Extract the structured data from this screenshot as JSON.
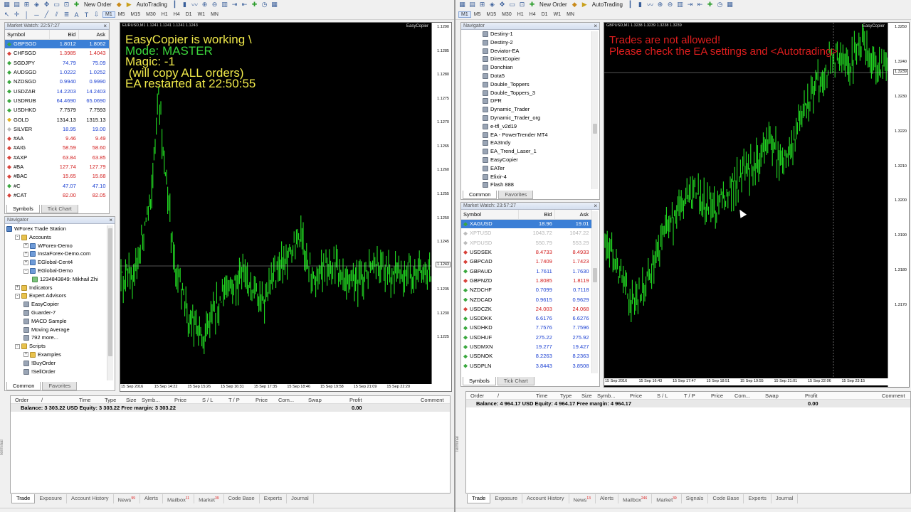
{
  "toolbar": {
    "new_order": "New Order",
    "autotrading": "AutoTrading",
    "timeframes": [
      "M1",
      "M5",
      "M15",
      "M30",
      "H1",
      "H4",
      "D1",
      "W1",
      "MN"
    ],
    "selected_timeframe": "M1"
  },
  "left": {
    "market_watch": {
      "title": "Market Watch: 22:57:27",
      "headers": {
        "symbol": "Symbol",
        "bid": "Bid",
        "ask": "Ask"
      },
      "rows": [
        {
          "symbol": "GBPSGD",
          "bid": "1.8012",
          "ask": "1.8062",
          "marker": "gr",
          "selected": true
        },
        {
          "symbol": "CHFSGD",
          "bid": "1.3985",
          "ask": "1.4043",
          "marker": "r",
          "color": "red"
        },
        {
          "symbol": "SGDJPY",
          "bid": "74.79",
          "ask": "75.09",
          "marker": "gr",
          "color": "blue"
        },
        {
          "symbol": "AUDSGD",
          "bid": "1.0222",
          "ask": "1.0252",
          "marker": "gr",
          "color": "blue"
        },
        {
          "symbol": "NZDSGD",
          "bid": "0.9940",
          "ask": "0.9990",
          "marker": "gr",
          "color": "blue"
        },
        {
          "symbol": "USDZAR",
          "bid": "14.2203",
          "ask": "14.2403",
          "marker": "gr",
          "color": "blue"
        },
        {
          "symbol": "USDRUB",
          "bid": "64.4690",
          "ask": "65.0690",
          "marker": "gr",
          "color": "blue"
        },
        {
          "symbol": "USDHKD",
          "bid": "7.7579",
          "ask": "7.7593",
          "marker": "gr",
          "color": ""
        },
        {
          "symbol": "GOLD",
          "bid": "1314.13",
          "ask": "1315.13",
          "marker": "y",
          "color": ""
        },
        {
          "symbol": "SILVER",
          "bid": "18.95",
          "ask": "19.00",
          "marker": "gy",
          "color": "blue"
        },
        {
          "symbol": "#AA",
          "bid": "9.46",
          "ask": "9.49",
          "marker": "r",
          "color": "red"
        },
        {
          "symbol": "#AIG",
          "bid": "58.59",
          "ask": "58.60",
          "marker": "r",
          "color": "red"
        },
        {
          "symbol": "#AXP",
          "bid": "63.84",
          "ask": "63.85",
          "marker": "r",
          "color": "red"
        },
        {
          "symbol": "#BA",
          "bid": "127.74",
          "ask": "127.79",
          "marker": "r",
          "color": "red"
        },
        {
          "symbol": "#BAC",
          "bid": "15.65",
          "ask": "15.68",
          "marker": "r",
          "color": "red"
        },
        {
          "symbol": "#C",
          "bid": "47.07",
          "ask": "47.10",
          "marker": "gr",
          "color": "blue"
        },
        {
          "symbol": "#CAT",
          "bid": "82.00",
          "ask": "82.05",
          "marker": "r",
          "color": "red"
        }
      ],
      "tabs": [
        "Symbols",
        "Tick Chart"
      ]
    },
    "navigator": {
      "title": "Navigator",
      "items": [
        {
          "text": "WForex Trade Station",
          "indent": 0,
          "icon": "pc"
        },
        {
          "text": "Accounts",
          "indent": 1,
          "icon": "fold",
          "exp": "-"
        },
        {
          "text": "WForex-Demo",
          "indent": 2,
          "icon": "acct",
          "exp": "+"
        },
        {
          "text": "InstaForex-Demo.com",
          "indent": 2,
          "icon": "acct",
          "exp": "+"
        },
        {
          "text": "EGlobal-Cent4",
          "indent": 2,
          "icon": "acct",
          "exp": "+"
        },
        {
          "text": "EGlobal-Demo",
          "indent": 2,
          "icon": "acct",
          "exp": "-"
        },
        {
          "text": "1234843849: Mikhail Zhi",
          "indent": 3,
          "icon": "ind"
        },
        {
          "text": "Indicators",
          "indent": 1,
          "icon": "fold",
          "exp": "+"
        },
        {
          "text": "Expert Advisors",
          "indent": 1,
          "icon": "fold",
          "exp": "-"
        },
        {
          "text": "EasyCopier",
          "indent": 2,
          "icon": "ea"
        },
        {
          "text": "Guarder-7",
          "indent": 2,
          "icon": "ea"
        },
        {
          "text": "MACD Sample",
          "indent": 2,
          "icon": "ea"
        },
        {
          "text": "Moving Average",
          "indent": 2,
          "icon": "ea"
        },
        {
          "text": "792 more...",
          "indent": 2,
          "icon": "ea"
        },
        {
          "text": "Scripts",
          "indent": 1,
          "icon": "fold",
          "exp": "-"
        },
        {
          "text": "Examples",
          "indent": 2,
          "icon": "fold",
          "exp": "+"
        },
        {
          "text": "!BuyOrder",
          "indent": 2,
          "icon": "ea"
        },
        {
          "text": "!SellOrder",
          "indent": 2,
          "icon": "ea"
        }
      ],
      "tabs": [
        "Common",
        "Favorites"
      ]
    },
    "chart": {
      "header": "EURUSD,M1  1.1241 1.1241 1.1241 1.1243",
      "logo": "EasyCopier",
      "overlay": [
        "EasyCopier is working \\",
        "Mode: MASTER",
        "Magic: -1",
        " (will copy ALL orders)",
        "EA restarted at 22:50:55"
      ],
      "overlay_colors": [
        "#f0e94a",
        "#3cd63c",
        "#f0e94a",
        "#f0e94a",
        "#f0e94a"
      ],
      "price_ticks": [
        "1.1290",
        "1.1285",
        "1.1280",
        "1.1275",
        "1.1270",
        "1.1265",
        "1.1260",
        "1.1255",
        "1.1250",
        "1.1245",
        "1.1240",
        "1.1235",
        "1.1230",
        "1.1225"
      ],
      "current_price": "1.1243",
      "time_ticks": [
        "15 Sep 2016",
        "15 Sep 14:22",
        "15 Sep 15:26",
        "15 Sep 16:31",
        "15 Sep 17:35",
        "15 Sep 18:46",
        "15 Sep 19:58",
        "15 Sep 21:09",
        "15 Sep 22:20"
      ]
    },
    "terminal": {
      "headers": [
        "Order",
        "/",
        "Time",
        "Type",
        "Size",
        "Symb...",
        "Price",
        "S / L",
        "T / P",
        "Price",
        "Com...",
        "Swap",
        "Profit",
        "Comment"
      ],
      "balance": "Balance: 3 303.22 USD  Equity: 3 303.22  Free margin: 3 303.22",
      "profit": "0.00",
      "tabs": [
        {
          "label": "Trade",
          "badge": ""
        },
        {
          "label": "Exposure",
          "badge": ""
        },
        {
          "label": "Account History",
          "badge": ""
        },
        {
          "label": "News",
          "badge": "99"
        },
        {
          "label": "Alerts",
          "badge": ""
        },
        {
          "label": "Mailbox",
          "badge": "11"
        },
        {
          "label": "Market",
          "badge": "39"
        },
        {
          "label": "Code Base",
          "badge": ""
        },
        {
          "label": "Experts",
          "badge": ""
        },
        {
          "label": "Journal",
          "badge": ""
        }
      ],
      "side_label": "Terminal"
    }
  },
  "right": {
    "navigator": {
      "title": "Navigator",
      "items": [
        "Destiny-1",
        "Destiny-2",
        "Deviator-EA",
        "DirectCopier",
        "Donchian",
        "Dota5",
        "Double_Toppers",
        "Double_Toppers_3",
        "DPR",
        "Dynamic_Trader",
        "Dynamic_Trader_org",
        "e-tfl_v2d19",
        "EA - PowerTrender MT4",
        "EA3Indy",
        "EA_Trend_Laser_1",
        "EasyCopier",
        "EATer",
        "Elixir-4",
        "Flash 888"
      ],
      "tabs": [
        "Common",
        "Favorites"
      ]
    },
    "market_watch": {
      "title": "Market Watch: 23:57:27",
      "headers": {
        "symbol": "Symbol",
        "bid": "Bid",
        "ask": "Ask"
      },
      "rows": [
        {
          "symbol": "XAGUSD",
          "bid": "18.96",
          "ask": "19.01",
          "marker": "gr",
          "selected": true
        },
        {
          "symbol": "XPTUSD",
          "bid": "1043.72",
          "ask": "1047.22",
          "marker": "gy",
          "grey": true
        },
        {
          "symbol": "XPDUSD",
          "bid": "550.79",
          "ask": "553.29",
          "marker": "gy",
          "grey": true
        },
        {
          "symbol": "USDSEK",
          "bid": "8.4733",
          "ask": "8.4933",
          "marker": "r",
          "color": "red"
        },
        {
          "symbol": "GBPCAD",
          "bid": "1.7409",
          "ask": "1.7423",
          "marker": "r",
          "color": "red"
        },
        {
          "symbol": "GBPAUD",
          "bid": "1.7611",
          "ask": "1.7630",
          "marker": "gr",
          "color": "blue"
        },
        {
          "symbol": "GBPNZD",
          "bid": "1.8085",
          "ask": "1.8119",
          "marker": "r",
          "color": "red"
        },
        {
          "symbol": "NZDCHF",
          "bid": "0.7099",
          "ask": "0.7118",
          "marker": "gr",
          "color": "blue"
        },
        {
          "symbol": "NZDCAD",
          "bid": "0.9615",
          "ask": "0.9629",
          "marker": "gr",
          "color": "blue"
        },
        {
          "symbol": "USDCZK",
          "bid": "24.003",
          "ask": "24.068",
          "marker": "r",
          "color": "red"
        },
        {
          "symbol": "USDDKK",
          "bid": "6.6176",
          "ask": "6.6276",
          "marker": "gr",
          "color": "blue"
        },
        {
          "symbol": "USDHKD",
          "bid": "7.7576",
          "ask": "7.7596",
          "marker": "gr",
          "color": "blue"
        },
        {
          "symbol": "USDHUF",
          "bid": "275.22",
          "ask": "275.92",
          "marker": "gr",
          "color": "blue"
        },
        {
          "symbol": "USDMXN",
          "bid": "19.277",
          "ask": "19.427",
          "marker": "gr",
          "color": "blue"
        },
        {
          "symbol": "USDNOK",
          "bid": "8.2263",
          "ask": "8.2363",
          "marker": "gr",
          "color": "blue"
        },
        {
          "symbol": "USDPLN",
          "bid": "3.8443",
          "ask": "3.8508",
          "marker": "gr",
          "color": "blue"
        }
      ],
      "tabs": [
        "Symbols",
        "Tick Chart"
      ]
    },
    "chart": {
      "header": "GBPUSD,M1  1.3238 1.3239 1.3238 1.3239",
      "logo": "EasyCopier",
      "overlay": [
        "Trades are not allowed!",
        "Please check the EA settings and <Autotrading>"
      ],
      "overlay_color": "#e01e1e",
      "price_ticks": [
        "1.3250",
        "1.3240",
        "1.3230",
        "1.3220",
        "1.3210",
        "1.3200",
        "1.3190",
        "1.3180",
        "1.3170"
      ],
      "current_price": "1.3239",
      "time_ticks": [
        "15 Sep 2016",
        "15 Sep 16:43",
        "15 Sep 17:47",
        "15 Sep 18:51",
        "15 Sep 19:55",
        "15 Sep 21:01",
        "15 Sep 22:06",
        "15 Sep 23:15"
      ]
    },
    "terminal": {
      "headers": [
        "Order",
        "/",
        "Time",
        "Type",
        "Size",
        "Symb...",
        "Price",
        "S / L",
        "T / P",
        "Price",
        "Com...",
        "Swap",
        "Profit",
        "Comment"
      ],
      "balance": "Balance: 4 964.17 USD  Equity: 4 964.17  Free margin: 4 964.17",
      "profit": "0.00",
      "tabs": [
        {
          "label": "Trade",
          "badge": ""
        },
        {
          "label": "Exposure",
          "badge": ""
        },
        {
          "label": "Account History",
          "badge": ""
        },
        {
          "label": "News",
          "badge": "13"
        },
        {
          "label": "Alerts",
          "badge": ""
        },
        {
          "label": "Mailbox",
          "badge": "246"
        },
        {
          "label": "Market",
          "badge": "39"
        },
        {
          "label": "Signals",
          "badge": ""
        },
        {
          "label": "Code Base",
          "badge": ""
        },
        {
          "label": "Experts",
          "badge": ""
        },
        {
          "label": "Journal",
          "badge": ""
        }
      ],
      "side_label": "Terminal"
    }
  },
  "colors": {
    "candle": "#22dd22",
    "selected_row": "#3b7fd6"
  }
}
